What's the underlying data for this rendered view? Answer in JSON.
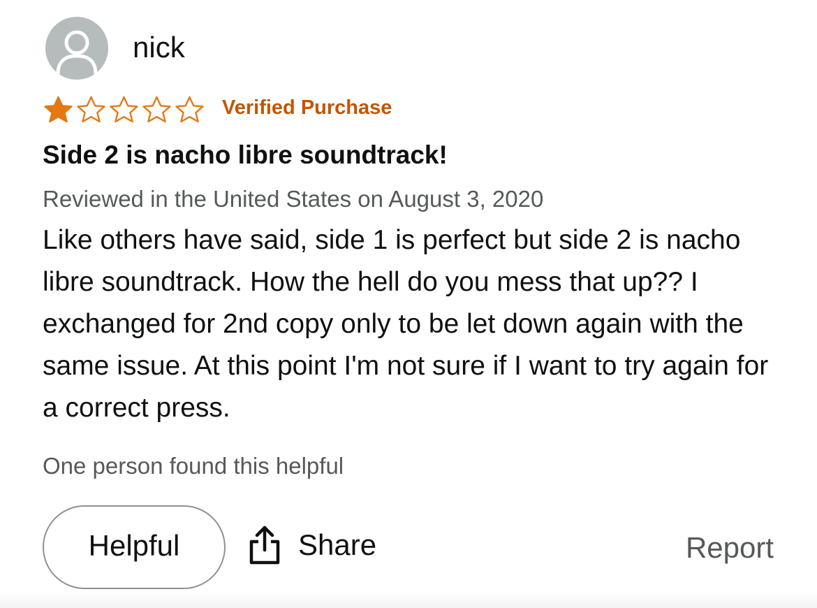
{
  "review": {
    "author": {
      "name": "nick",
      "avatar_icon": "default-user-icon"
    },
    "rating": {
      "value": 1,
      "max": 5
    },
    "verified_label": "Verified Purchase",
    "title": "Side 2 is nacho libre soundtrack!",
    "meta": "Reviewed in the United States on August 3, 2020",
    "body": "Like others have said, side 1 is perfect but side 2 is nacho libre soundtrack. How the hell do you mess that up?? I exchanged for 2nd copy only to be let down again with the same issue. At this point I'm not sure if I want to try again for a correct press.",
    "helpful_count_text": "One person found this helpful"
  },
  "actions": {
    "helpful_label": "Helpful",
    "share_label": "Share",
    "share_icon": "share-icon",
    "report_label": "Report"
  },
  "colors": {
    "star": "#e47911",
    "verified": "#c45500",
    "secondary_text": "#565959",
    "avatar_bg": "#b6bcbc"
  }
}
